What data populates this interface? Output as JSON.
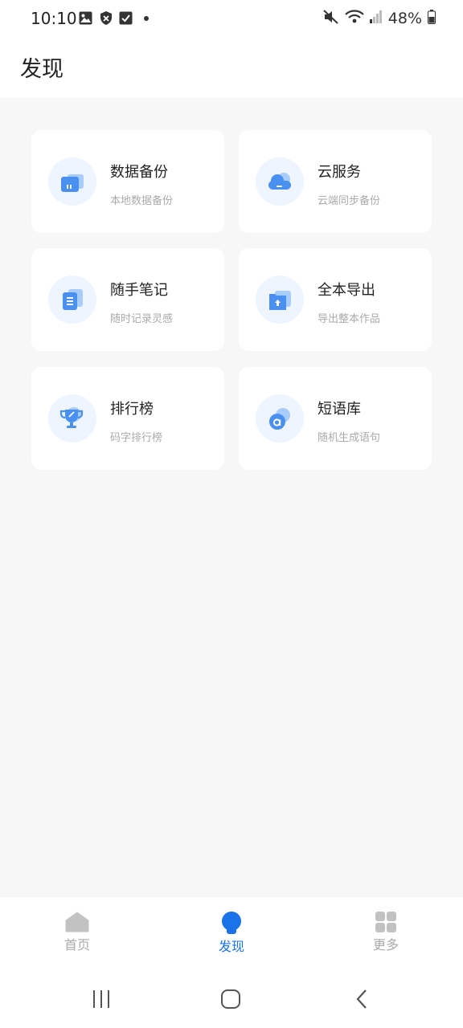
{
  "status_bar": {
    "time": "10:10",
    "battery": "48%"
  },
  "header": {
    "title": "发现"
  },
  "cards": [
    {
      "title": "数据备份",
      "subtitle": "本地数据备份",
      "icon": "backup-icon"
    },
    {
      "title": "云服务",
      "subtitle": "云端同步备份",
      "icon": "cloud-icon"
    },
    {
      "title": "随手笔记",
      "subtitle": "随时记录灵感",
      "icon": "note-icon"
    },
    {
      "title": "全本导出",
      "subtitle": "导出整本作品",
      "icon": "export-icon"
    },
    {
      "title": "排行榜",
      "subtitle": "码字排行榜",
      "icon": "trophy-icon"
    },
    {
      "title": "短语库",
      "subtitle": "随机生成语句",
      "icon": "phrase-icon"
    }
  ],
  "bottom_nav": [
    {
      "label": "首页",
      "icon": "home-icon",
      "active": false
    },
    {
      "label": "发现",
      "icon": "discover-icon",
      "active": true
    },
    {
      "label": "更多",
      "icon": "grid-icon",
      "active": false
    }
  ],
  "colors": {
    "accent": "#1a73e8",
    "icon_blue": "#4a90f0",
    "icon_light": "#a9cdfb",
    "icon_bg": "#eef5ff"
  }
}
